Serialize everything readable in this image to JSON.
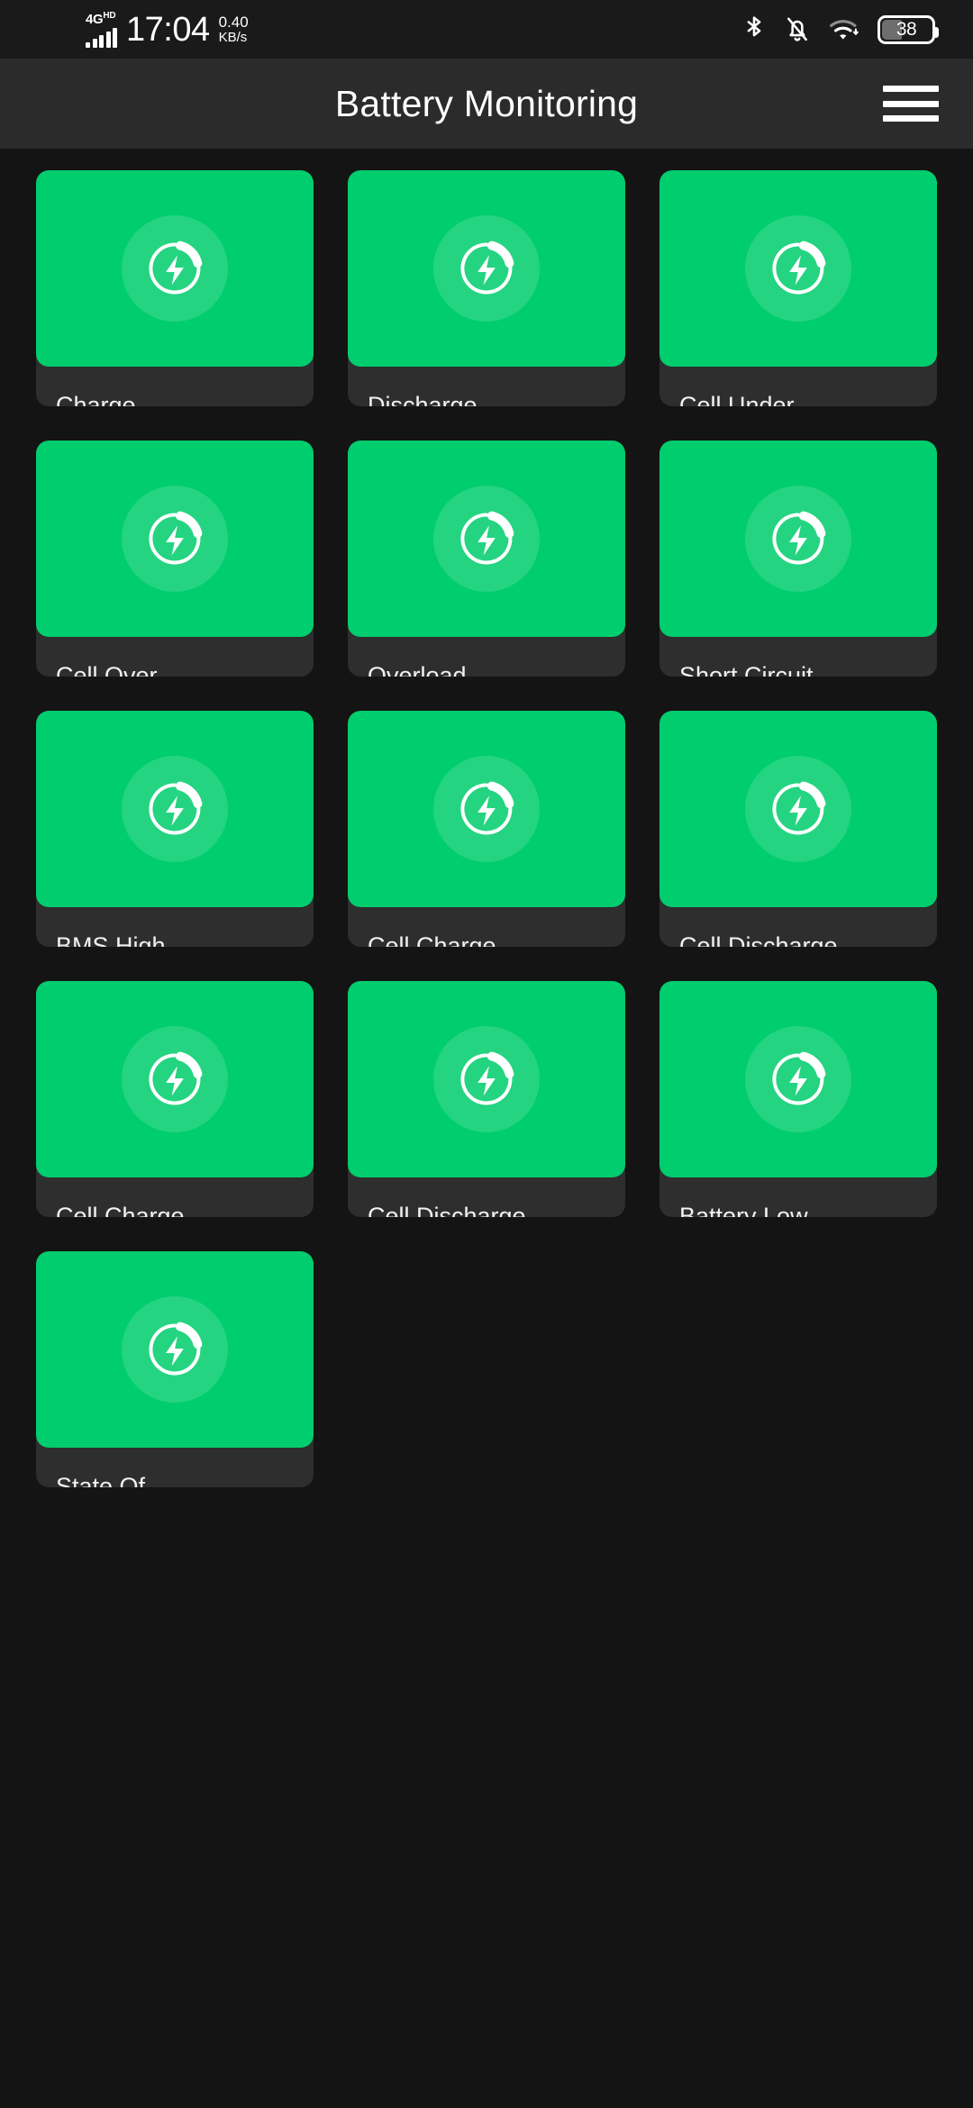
{
  "status_bar": {
    "network_type": "4G",
    "network_suffix": "HD",
    "signal_icon": "signal-bars-icon",
    "time": "17:04",
    "net_speed_rate": "0.40",
    "net_speed_unit": "KB/s",
    "bluetooth_icon": "bluetooth-icon",
    "notifications_icon": "bell-muted-icon",
    "wifi_icon": "wifi-icon",
    "battery_icon": "battery-icon",
    "battery_level": "38"
  },
  "app_bar": {
    "title": "Battery Monitoring",
    "menu_icon": "hamburger-menu-icon"
  },
  "colors": {
    "accent_green": "#00cd6d",
    "card_body": "#2e2e2e",
    "page_background": "#141414",
    "app_bar_background": "#2b2b2b",
    "status_bar_background": "#1a1a1a"
  },
  "grid": {
    "status_icon": "battery-charge-icon",
    "cards": [
      {
        "label": "Charge\nDisable"
      },
      {
        "label": "Discharge\nDisable"
      },
      {
        "label": "Cell Under\nVoltage"
      },
      {
        "label": "Cell Over\nVoltage"
      },
      {
        "label": "Overload\nState"
      },
      {
        "label": "Short Circuit\nState"
      },
      {
        "label": "BMS High\nTemperature"
      },
      {
        "label": "Cell Charge\nHigh Temp"
      },
      {
        "label": "Cell Discharge\nHigh Temp"
      },
      {
        "label": "Cell Charge\nLow Temp"
      },
      {
        "label": "Cell Discharge\nLow Temp"
      },
      {
        "label": "Battery Low\nVoltage"
      },
      {
        "label": "State Of\nHealth"
      }
    ]
  }
}
